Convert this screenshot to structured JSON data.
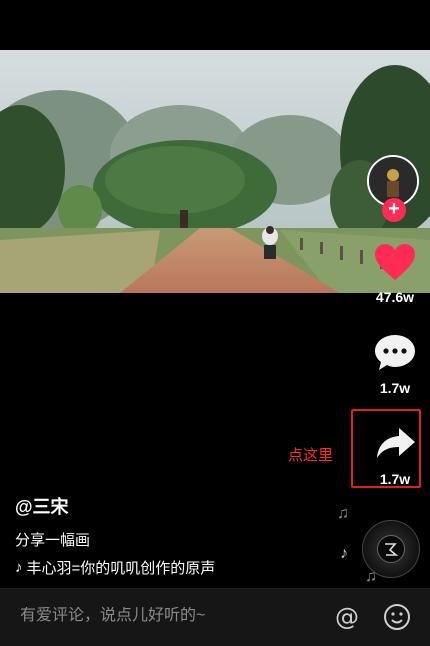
{
  "video": {
    "description": "Landscape video thumbnail of a dirt road with a large tree and a motorcyclist"
  },
  "right_panel": {
    "avatar_icon": "user-avatar",
    "follow_icon": "plus-icon",
    "like": {
      "icon": "heart-icon",
      "count": "47.6w",
      "color": "#fe2c55"
    },
    "comment": {
      "icon": "comment-bubble-icon",
      "count": "1.7w"
    },
    "share": {
      "icon": "share-arrow-icon",
      "count": "1.7w"
    }
  },
  "annotation": {
    "hint": "点这里",
    "highlight_color": "#e02020"
  },
  "info": {
    "username": "@三宋",
    "caption": "分享一幅画",
    "music": "丰心羽=你的叽叽创作的原声"
  },
  "music_disc": {
    "icon": "music-disc-icon"
  },
  "comment_bar": {
    "placeholder": "有爱评论，说点儿好听的~",
    "at_icon": "at-icon",
    "emoji_icon": "emoji-icon"
  }
}
